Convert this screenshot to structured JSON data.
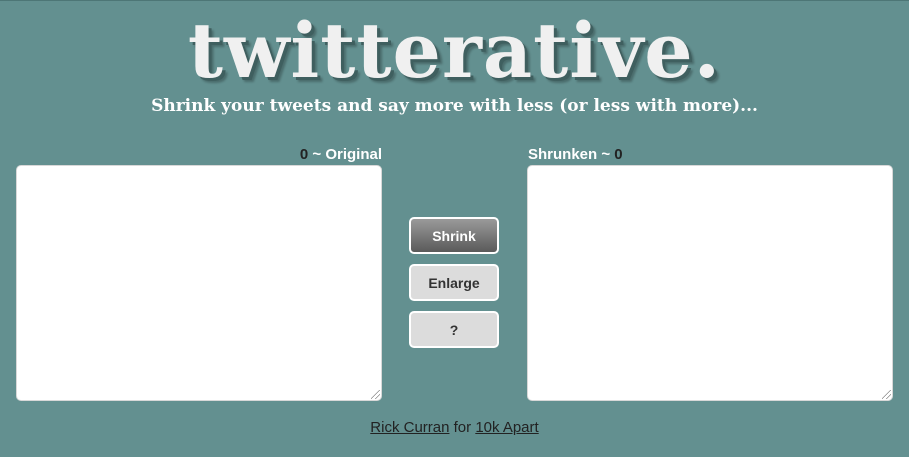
{
  "header": {
    "logo_text": "twitterative.",
    "tagline": "Shrink your tweets and say more with less (or less with more)..."
  },
  "original": {
    "count": "0",
    "label": " ~ Original",
    "value": ""
  },
  "shrunken": {
    "label": "Shrunken ~ ",
    "count": "0",
    "value": ""
  },
  "buttons": {
    "shrink": "Shrink",
    "enlarge": "Enlarge",
    "help": "?"
  },
  "footer": {
    "author_link": "Rick Curran",
    "for_text": " for ",
    "event_link": "10k Apart"
  },
  "colors": {
    "background": "#639090",
    "shrink_button_top": "#9a9a9a",
    "shrink_button_bottom": "#5a5a5a",
    "secondary_button": "#dcdcdc"
  }
}
